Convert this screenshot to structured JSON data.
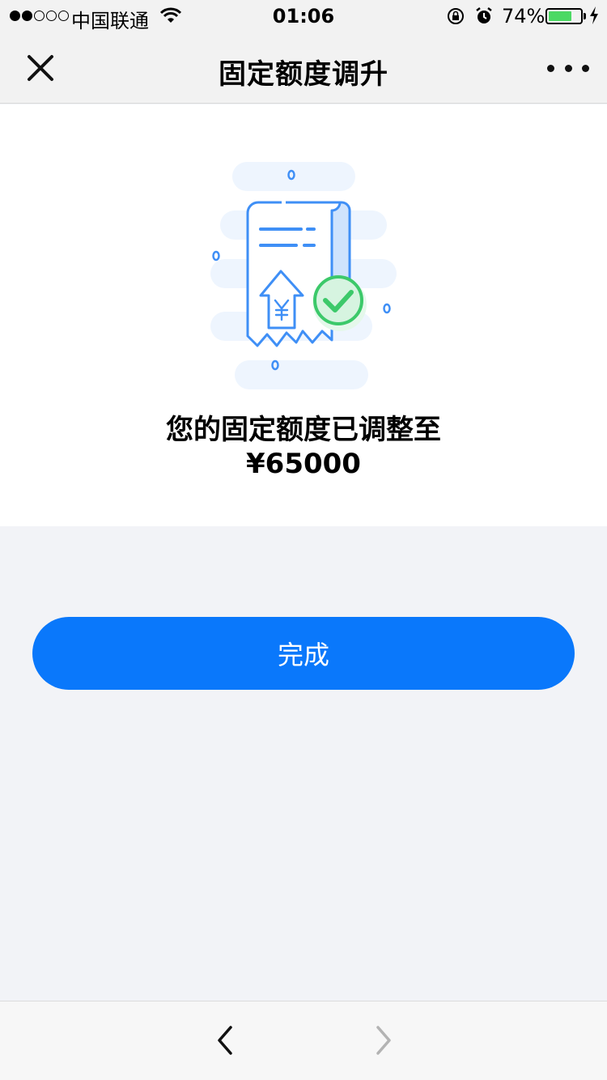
{
  "status_bar": {
    "carrier": "中国联通",
    "time": "01:06",
    "battery": "74%",
    "battery_level": 0.74
  },
  "nav": {
    "title": "固定额度调升"
  },
  "result": {
    "message": "您的固定额度已调整至",
    "amount": "¥65000"
  },
  "actions": {
    "done_label": "完成"
  },
  "colors": {
    "primary": "#0a78fb",
    "success": "#3cc96a",
    "illustration_blue": "#3f8ff6",
    "page_bg": "#f2f3f7"
  }
}
